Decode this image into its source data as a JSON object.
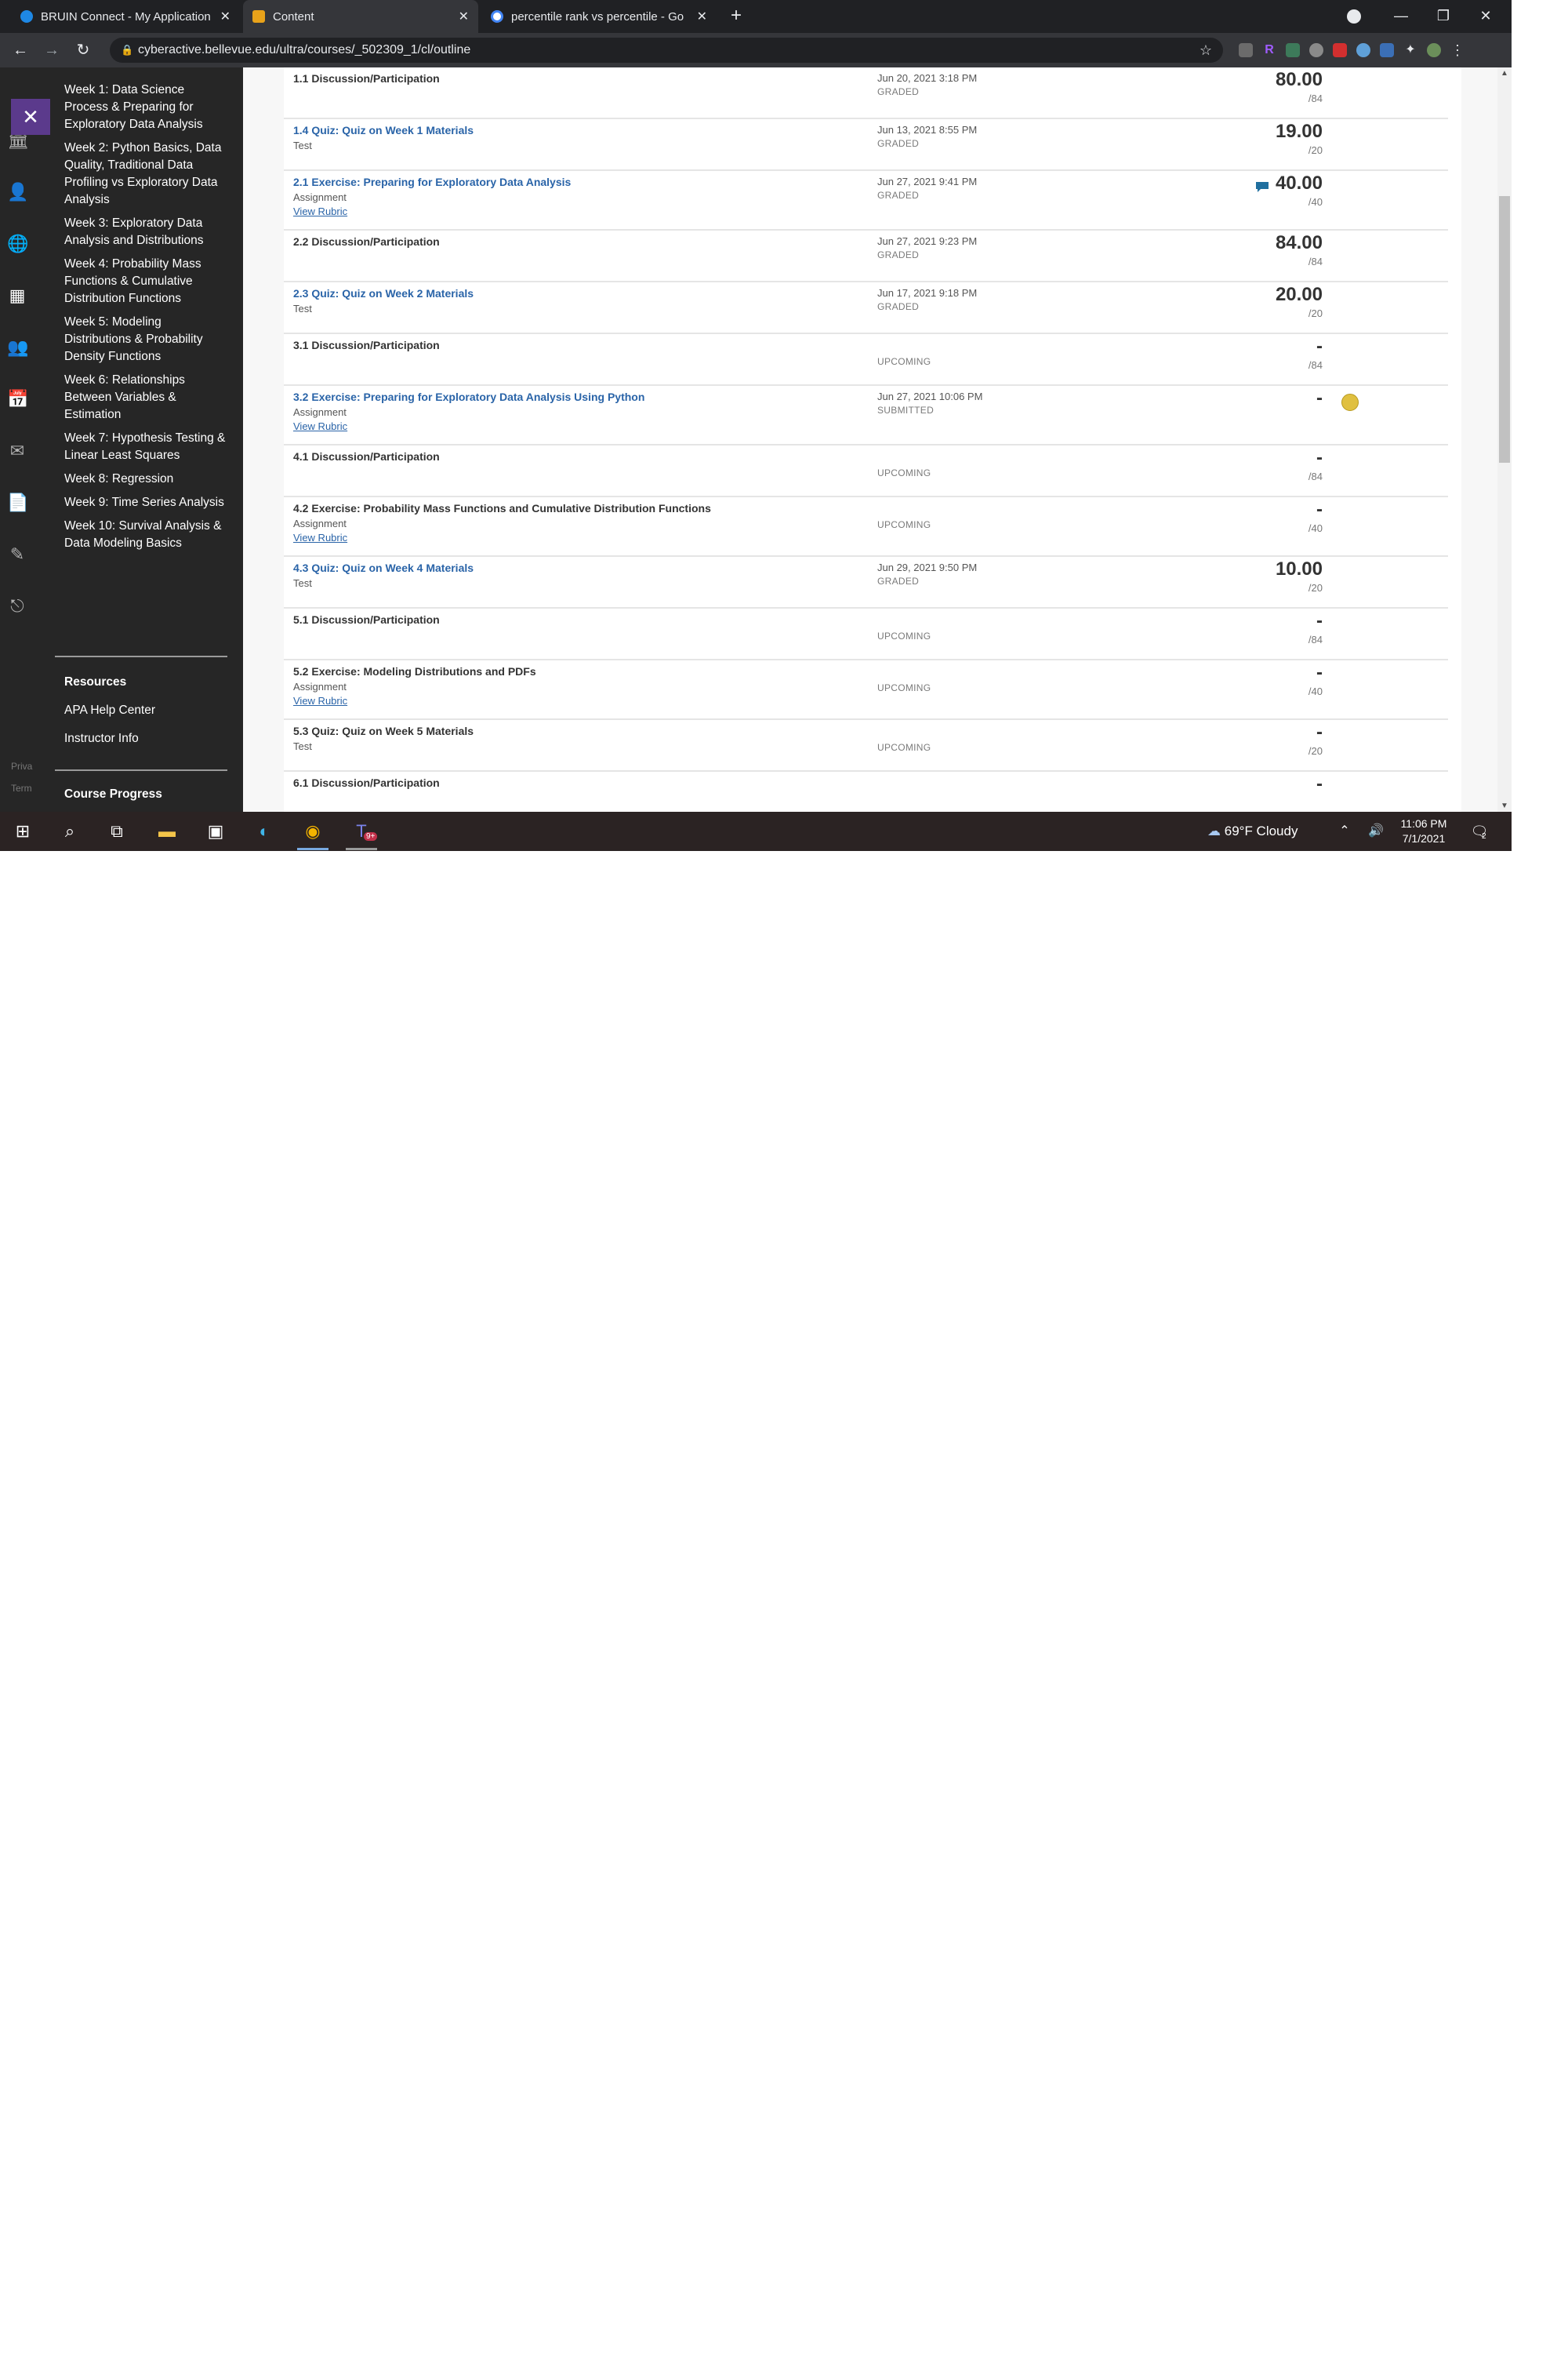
{
  "browser": {
    "tabs": [
      {
        "title": "BRUIN Connect - My Application",
        "active": false
      },
      {
        "title": "Content",
        "active": true
      },
      {
        "title": "percentile rank vs percentile - Go",
        "active": false
      }
    ],
    "new_tab": "+",
    "url": "cyberactive.bellevue.edu/ultra/courses/_502309_1/cl/outline"
  },
  "course_nav": {
    "weeks": [
      "Week 1: Data Science Process & Preparing for Exploratory Data Analysis",
      "Week 2: Python Basics, Data Quality, Traditional Data Profiling vs Exploratory Data Analysis",
      "Week 3: Exploratory Data Analysis and Distributions",
      "Week 4: Probability Mass Functions & Cumulative Distribution Functions",
      "Week 5: Modeling Distributions & Probability Density Functions",
      "Week 6: Relationships Between Variables & Estimation",
      "Week 7: Hypothesis Testing & Linear Least Squares",
      "Week 8: Regression",
      "Week 9: Time Series Analysis",
      "Week 10: Survival Analysis & Data Modeling Basics"
    ],
    "resources_title": "Resources",
    "resources": [
      "APA Help Center",
      "Instructor Info"
    ],
    "progress_title": "Course Progress"
  },
  "rail": {
    "privacy_partial": "Priva",
    "terms_partial": "Term"
  },
  "grades": [
    {
      "title": "1.1 Discussion/Participation",
      "link": false,
      "type": "",
      "rubric": "",
      "date": "Jun 20, 2021 3:18 PM",
      "status": "GRADED",
      "score": "80.00",
      "max": "/84",
      "comment": false,
      "emoji": false
    },
    {
      "title": "1.4 Quiz: Quiz on Week 1 Materials",
      "link": true,
      "type": "Test",
      "rubric": "",
      "date": "Jun 13, 2021 8:55 PM",
      "status": "GRADED",
      "score": "19.00",
      "max": "/20",
      "comment": false,
      "emoji": false
    },
    {
      "title": "2.1 Exercise: Preparing for Exploratory Data Analysis",
      "link": true,
      "type": "Assignment",
      "rubric": "View Rubric",
      "date": "Jun 27, 2021 9:41 PM",
      "status": "GRADED",
      "score": "40.00",
      "max": "/40",
      "comment": true,
      "emoji": false
    },
    {
      "title": "2.2 Discussion/Participation",
      "link": false,
      "type": "",
      "rubric": "",
      "date": "Jun 27, 2021 9:23 PM",
      "status": "GRADED",
      "score": "84.00",
      "max": "/84",
      "comment": false,
      "emoji": false
    },
    {
      "title": "2.3 Quiz: Quiz on Week 2 Materials",
      "link": true,
      "type": "Test",
      "rubric": "",
      "date": "Jun 17, 2021 9:18 PM",
      "status": "GRADED",
      "score": "20.00",
      "max": "/20",
      "comment": false,
      "emoji": false
    },
    {
      "title": "3.1 Discussion/Participation",
      "link": false,
      "type": "",
      "rubric": "",
      "date": "",
      "status": "UPCOMING",
      "score": "-",
      "max": "/84",
      "comment": false,
      "emoji": false
    },
    {
      "title": "3.2 Exercise: Preparing for Exploratory Data Analysis Using Python",
      "link": true,
      "type": "Assignment",
      "rubric": "View Rubric",
      "date": "Jun 27, 2021 10:06 PM",
      "status": "SUBMITTED",
      "score": "-",
      "max": "",
      "comment": false,
      "emoji": true
    },
    {
      "title": "4.1 Discussion/Participation",
      "link": false,
      "type": "",
      "rubric": "",
      "date": "",
      "status": "UPCOMING",
      "score": "-",
      "max": "/84",
      "comment": false,
      "emoji": false
    },
    {
      "title": "4.2 Exercise: Probability Mass Functions and Cumulative Distribution Functions",
      "link": false,
      "type": "Assignment",
      "rubric": "View Rubric",
      "date": "",
      "status": "UPCOMING",
      "score": "-",
      "max": "/40",
      "comment": false,
      "emoji": false
    },
    {
      "title": "4.3 Quiz: Quiz on Week 4 Materials",
      "link": true,
      "type": "Test",
      "rubric": "",
      "date": "Jun 29, 2021 9:50 PM",
      "status": "GRADED",
      "score": "10.00",
      "max": "/20",
      "comment": false,
      "emoji": false
    },
    {
      "title": "5.1 Discussion/Participation",
      "link": false,
      "type": "",
      "rubric": "",
      "date": "",
      "status": "UPCOMING",
      "score": "-",
      "max": "/84",
      "comment": false,
      "emoji": false
    },
    {
      "title": "5.2 Exercise: Modeling Distributions and PDFs",
      "link": false,
      "type": "Assignment",
      "rubric": "View Rubric",
      "date": "",
      "status": "UPCOMING",
      "score": "-",
      "max": "/40",
      "comment": false,
      "emoji": false
    },
    {
      "title": "5.3 Quiz: Quiz on Week 5 Materials",
      "link": false,
      "type": "Test",
      "rubric": "",
      "date": "",
      "status": "UPCOMING",
      "score": "-",
      "max": "/20",
      "comment": false,
      "emoji": false
    },
    {
      "title": "6.1 Discussion/Participation",
      "link": false,
      "type": "",
      "rubric": "",
      "date": "",
      "status": "",
      "score": "-",
      "max": "",
      "comment": false,
      "emoji": false
    }
  ],
  "taskbar": {
    "weather": "69°F  Cloudy",
    "time": "11:06 PM",
    "date": "7/1/2021",
    "teams_badge": "9+",
    "notification_count": "2"
  },
  "colors": {
    "accent": "#5b3a8c",
    "link": "#2a64a8",
    "nav_bg": "#262626"
  }
}
